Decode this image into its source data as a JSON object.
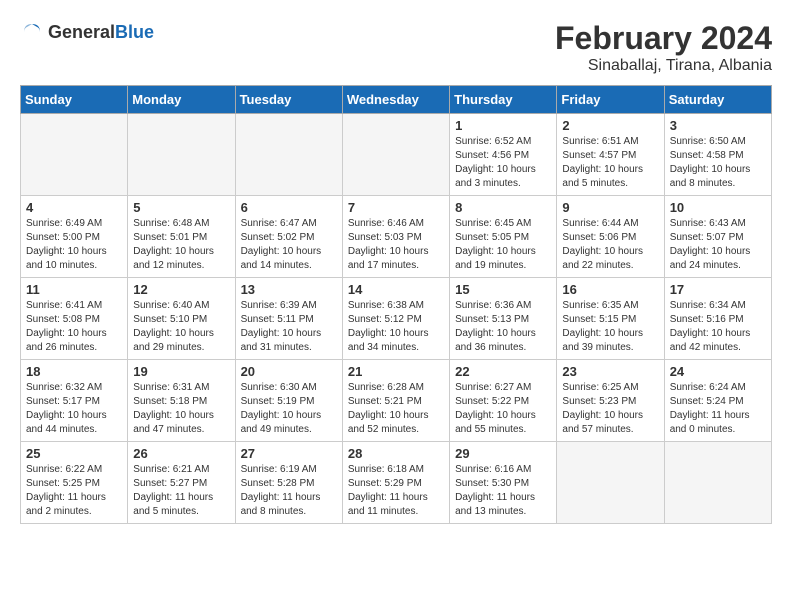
{
  "header": {
    "logo_general": "General",
    "logo_blue": "Blue",
    "month_year": "February 2024",
    "location": "Sinaballaj, Tirana, Albania"
  },
  "weekdays": [
    "Sunday",
    "Monday",
    "Tuesday",
    "Wednesday",
    "Thursday",
    "Friday",
    "Saturday"
  ],
  "weeks": [
    [
      {
        "day": "",
        "info": ""
      },
      {
        "day": "",
        "info": ""
      },
      {
        "day": "",
        "info": ""
      },
      {
        "day": "",
        "info": ""
      },
      {
        "day": "1",
        "info": "Sunrise: 6:52 AM\nSunset: 4:56 PM\nDaylight: 10 hours\nand 3 minutes."
      },
      {
        "day": "2",
        "info": "Sunrise: 6:51 AM\nSunset: 4:57 PM\nDaylight: 10 hours\nand 5 minutes."
      },
      {
        "day": "3",
        "info": "Sunrise: 6:50 AM\nSunset: 4:58 PM\nDaylight: 10 hours\nand 8 minutes."
      }
    ],
    [
      {
        "day": "4",
        "info": "Sunrise: 6:49 AM\nSunset: 5:00 PM\nDaylight: 10 hours\nand 10 minutes."
      },
      {
        "day": "5",
        "info": "Sunrise: 6:48 AM\nSunset: 5:01 PM\nDaylight: 10 hours\nand 12 minutes."
      },
      {
        "day": "6",
        "info": "Sunrise: 6:47 AM\nSunset: 5:02 PM\nDaylight: 10 hours\nand 14 minutes."
      },
      {
        "day": "7",
        "info": "Sunrise: 6:46 AM\nSunset: 5:03 PM\nDaylight: 10 hours\nand 17 minutes."
      },
      {
        "day": "8",
        "info": "Sunrise: 6:45 AM\nSunset: 5:05 PM\nDaylight: 10 hours\nand 19 minutes."
      },
      {
        "day": "9",
        "info": "Sunrise: 6:44 AM\nSunset: 5:06 PM\nDaylight: 10 hours\nand 22 minutes."
      },
      {
        "day": "10",
        "info": "Sunrise: 6:43 AM\nSunset: 5:07 PM\nDaylight: 10 hours\nand 24 minutes."
      }
    ],
    [
      {
        "day": "11",
        "info": "Sunrise: 6:41 AM\nSunset: 5:08 PM\nDaylight: 10 hours\nand 26 minutes."
      },
      {
        "day": "12",
        "info": "Sunrise: 6:40 AM\nSunset: 5:10 PM\nDaylight: 10 hours\nand 29 minutes."
      },
      {
        "day": "13",
        "info": "Sunrise: 6:39 AM\nSunset: 5:11 PM\nDaylight: 10 hours\nand 31 minutes."
      },
      {
        "day": "14",
        "info": "Sunrise: 6:38 AM\nSunset: 5:12 PM\nDaylight: 10 hours\nand 34 minutes."
      },
      {
        "day": "15",
        "info": "Sunrise: 6:36 AM\nSunset: 5:13 PM\nDaylight: 10 hours\nand 36 minutes."
      },
      {
        "day": "16",
        "info": "Sunrise: 6:35 AM\nSunset: 5:15 PM\nDaylight: 10 hours\nand 39 minutes."
      },
      {
        "day": "17",
        "info": "Sunrise: 6:34 AM\nSunset: 5:16 PM\nDaylight: 10 hours\nand 42 minutes."
      }
    ],
    [
      {
        "day": "18",
        "info": "Sunrise: 6:32 AM\nSunset: 5:17 PM\nDaylight: 10 hours\nand 44 minutes."
      },
      {
        "day": "19",
        "info": "Sunrise: 6:31 AM\nSunset: 5:18 PM\nDaylight: 10 hours\nand 47 minutes."
      },
      {
        "day": "20",
        "info": "Sunrise: 6:30 AM\nSunset: 5:19 PM\nDaylight: 10 hours\nand 49 minutes."
      },
      {
        "day": "21",
        "info": "Sunrise: 6:28 AM\nSunset: 5:21 PM\nDaylight: 10 hours\nand 52 minutes."
      },
      {
        "day": "22",
        "info": "Sunrise: 6:27 AM\nSunset: 5:22 PM\nDaylight: 10 hours\nand 55 minutes."
      },
      {
        "day": "23",
        "info": "Sunrise: 6:25 AM\nSunset: 5:23 PM\nDaylight: 10 hours\nand 57 minutes."
      },
      {
        "day": "24",
        "info": "Sunrise: 6:24 AM\nSunset: 5:24 PM\nDaylight: 11 hours\nand 0 minutes."
      }
    ],
    [
      {
        "day": "25",
        "info": "Sunrise: 6:22 AM\nSunset: 5:25 PM\nDaylight: 11 hours\nand 2 minutes."
      },
      {
        "day": "26",
        "info": "Sunrise: 6:21 AM\nSunset: 5:27 PM\nDaylight: 11 hours\nand 5 minutes."
      },
      {
        "day": "27",
        "info": "Sunrise: 6:19 AM\nSunset: 5:28 PM\nDaylight: 11 hours\nand 8 minutes."
      },
      {
        "day": "28",
        "info": "Sunrise: 6:18 AM\nSunset: 5:29 PM\nDaylight: 11 hours\nand 11 minutes."
      },
      {
        "day": "29",
        "info": "Sunrise: 6:16 AM\nSunset: 5:30 PM\nDaylight: 11 hours\nand 13 minutes."
      },
      {
        "day": "",
        "info": ""
      },
      {
        "day": "",
        "info": ""
      }
    ]
  ]
}
